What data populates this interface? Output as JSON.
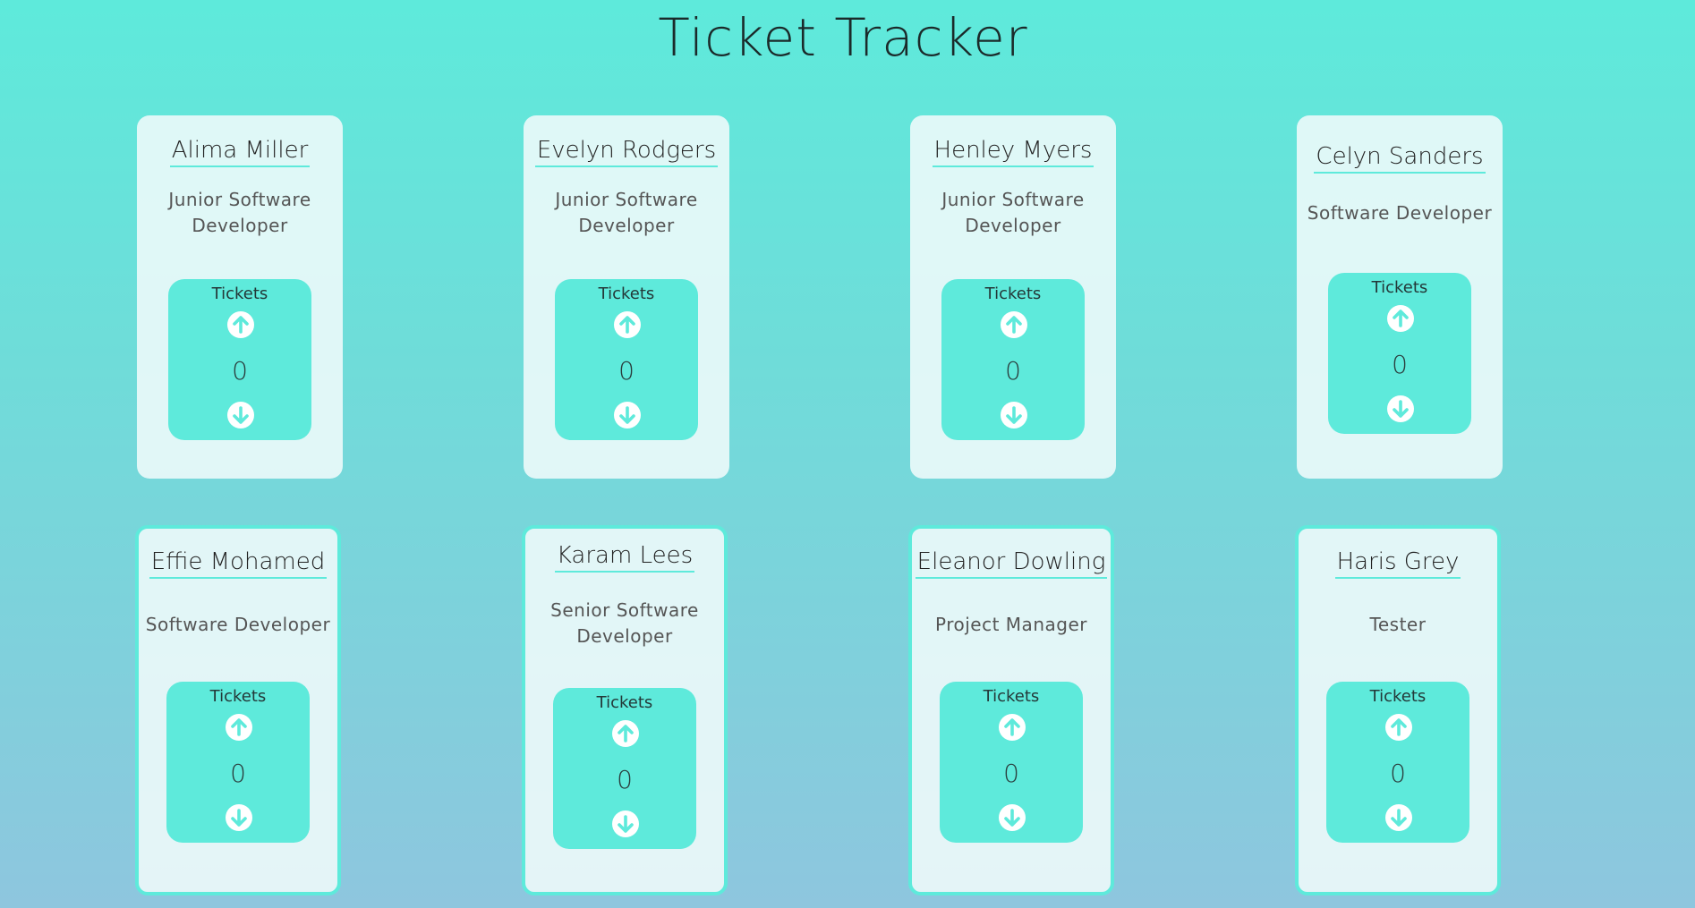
{
  "page": {
    "title": "Ticket Tracker"
  },
  "colors": {
    "accent": "#5eeadb",
    "card_bg": "#f0fafa",
    "background_top": "#5eeadb",
    "background_bottom": "#8ec6de"
  },
  "icons": {
    "increment": "arrow-up-circle-icon",
    "decrement": "arrow-down-circle-icon"
  },
  "employees": [
    {
      "name": "Alima Miller",
      "role_line1": "Junior Software",
      "role_line2": "Developer",
      "tickets_label": "Tickets",
      "count": "0"
    },
    {
      "name": "Evelyn Rodgers",
      "role_line1": "Junior Software",
      "role_line2": "Developer",
      "tickets_label": "Tickets",
      "count": "0"
    },
    {
      "name": "Henley Myers",
      "role_line1": "Junior Software",
      "role_line2": "Developer",
      "tickets_label": "Tickets",
      "count": "0"
    },
    {
      "name": "Celyn Sanders",
      "role_line1": "Software Developer",
      "role_line2": "",
      "tickets_label": "Tickets",
      "count": "0"
    },
    {
      "name": "Effie Mohamed",
      "role_line1": "Software Developer",
      "role_line2": "",
      "tickets_label": "Tickets",
      "count": "0"
    },
    {
      "name": "Karam Lees",
      "role_line1": "Senior Software",
      "role_line2": "Developer",
      "tickets_label": "Tickets",
      "count": "0"
    },
    {
      "name": "Eleanor Dowling",
      "role_line1": "Project Manager",
      "role_line2": "",
      "tickets_label": "Tickets",
      "count": "0"
    },
    {
      "name": "Haris Grey",
      "role_line1": "Tester",
      "role_line2": "",
      "tickets_label": "Tickets",
      "count": "0"
    }
  ]
}
